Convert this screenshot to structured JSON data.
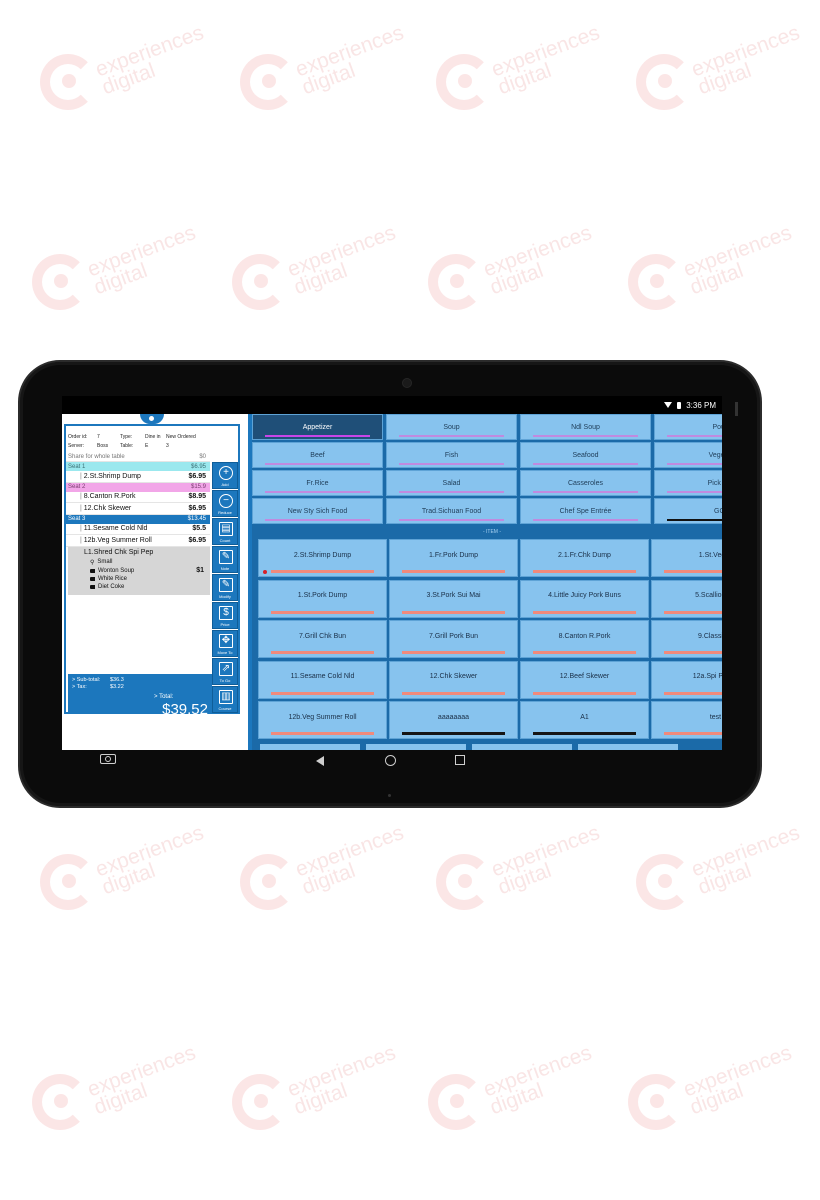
{
  "watermark": {
    "line1": "experiences",
    "line2": "digital"
  },
  "status": {
    "time": "3:36 PM"
  },
  "order": {
    "header": {
      "order_id_label": "Order id:",
      "order_id_value": "7",
      "type_label": "Type:",
      "type_value": "Dine in",
      "status_value": "New Ordered",
      "server_label": "Server:",
      "server_value": "Boss",
      "table_label": "Table:",
      "table_value": "E",
      "table_extra": "3"
    },
    "share": {
      "label": "Share for whole table",
      "price": "$0"
    },
    "seat1": {
      "label": "Seat 1",
      "total": "$6.95"
    },
    "seat1_items": [
      {
        "name": "2.St.Shrimp Dump",
        "price": "$6.95"
      }
    ],
    "seat2": {
      "label": "Seat 2",
      "total": "$15.9"
    },
    "seat2_items": [
      {
        "name": "8.Canton R.Pork",
        "price": "$8.95"
      },
      {
        "name": "12.Chk Skewer",
        "price": "$6.95"
      }
    ],
    "seat3": {
      "label": "Seat 3",
      "total": "$13.45"
    },
    "seat3_items": [
      {
        "name": "11.Sesame Cold Nld",
        "price": "$5.5"
      },
      {
        "name": "12b.Veg Summer Roll",
        "price": "$6.95"
      }
    ],
    "mod_item": {
      "name": "L1.Shred Chk Spi Pep",
      "price": "$1",
      "mods": [
        "Small",
        "Wonton Soup",
        "White Rice",
        "Diet Coke"
      ]
    },
    "tools": [
      "Add",
      "Reduce",
      "Count",
      "Note",
      "Modify",
      "Price",
      "Move To",
      "To Go",
      "Course"
    ],
    "totals": {
      "sub_label": "> Sub-total:",
      "sub_value": "$36.3",
      "tax_label": "> Tax:",
      "tax_value": "$3.22",
      "total_label": "> Total:",
      "total_value": "$39.52"
    }
  },
  "categories": [
    "Appetizer",
    "Soup",
    "Ndl Soup",
    "Poul",
    "Beef",
    "Fish",
    "Seafood",
    "Vegeta",
    "Fr.Rice",
    "Salad",
    "Casseroles",
    "Pick Pe",
    "New Sty Sich Food",
    "Trad.Sichuan Food",
    "Chef Spe Entrée",
    "GO"
  ],
  "item_divider": "- ITEM -",
  "items": [
    "2.St.Shrimp Dump",
    "1.Fr.Pork Dump",
    "2.1.Fr.Chk Dump",
    "1.St.Veg D",
    "1.St.Pork Dump",
    "3.St.Pork Sui Mai",
    "4.Little Juicy Pork Buns",
    "5.Scallion Pa",
    "7.Grill Chk Bun",
    "7.Grill Pork Bun",
    "8.Canton R.Pork",
    "9.Classic E",
    "11.Sesame Cold Nld",
    "12.Chk Skewer",
    "12.Beef Skewer",
    "12a.Spi Popco",
    "12b.Veg Summer Roll",
    "aaaaaaaa",
    "A1",
    "test"
  ]
}
